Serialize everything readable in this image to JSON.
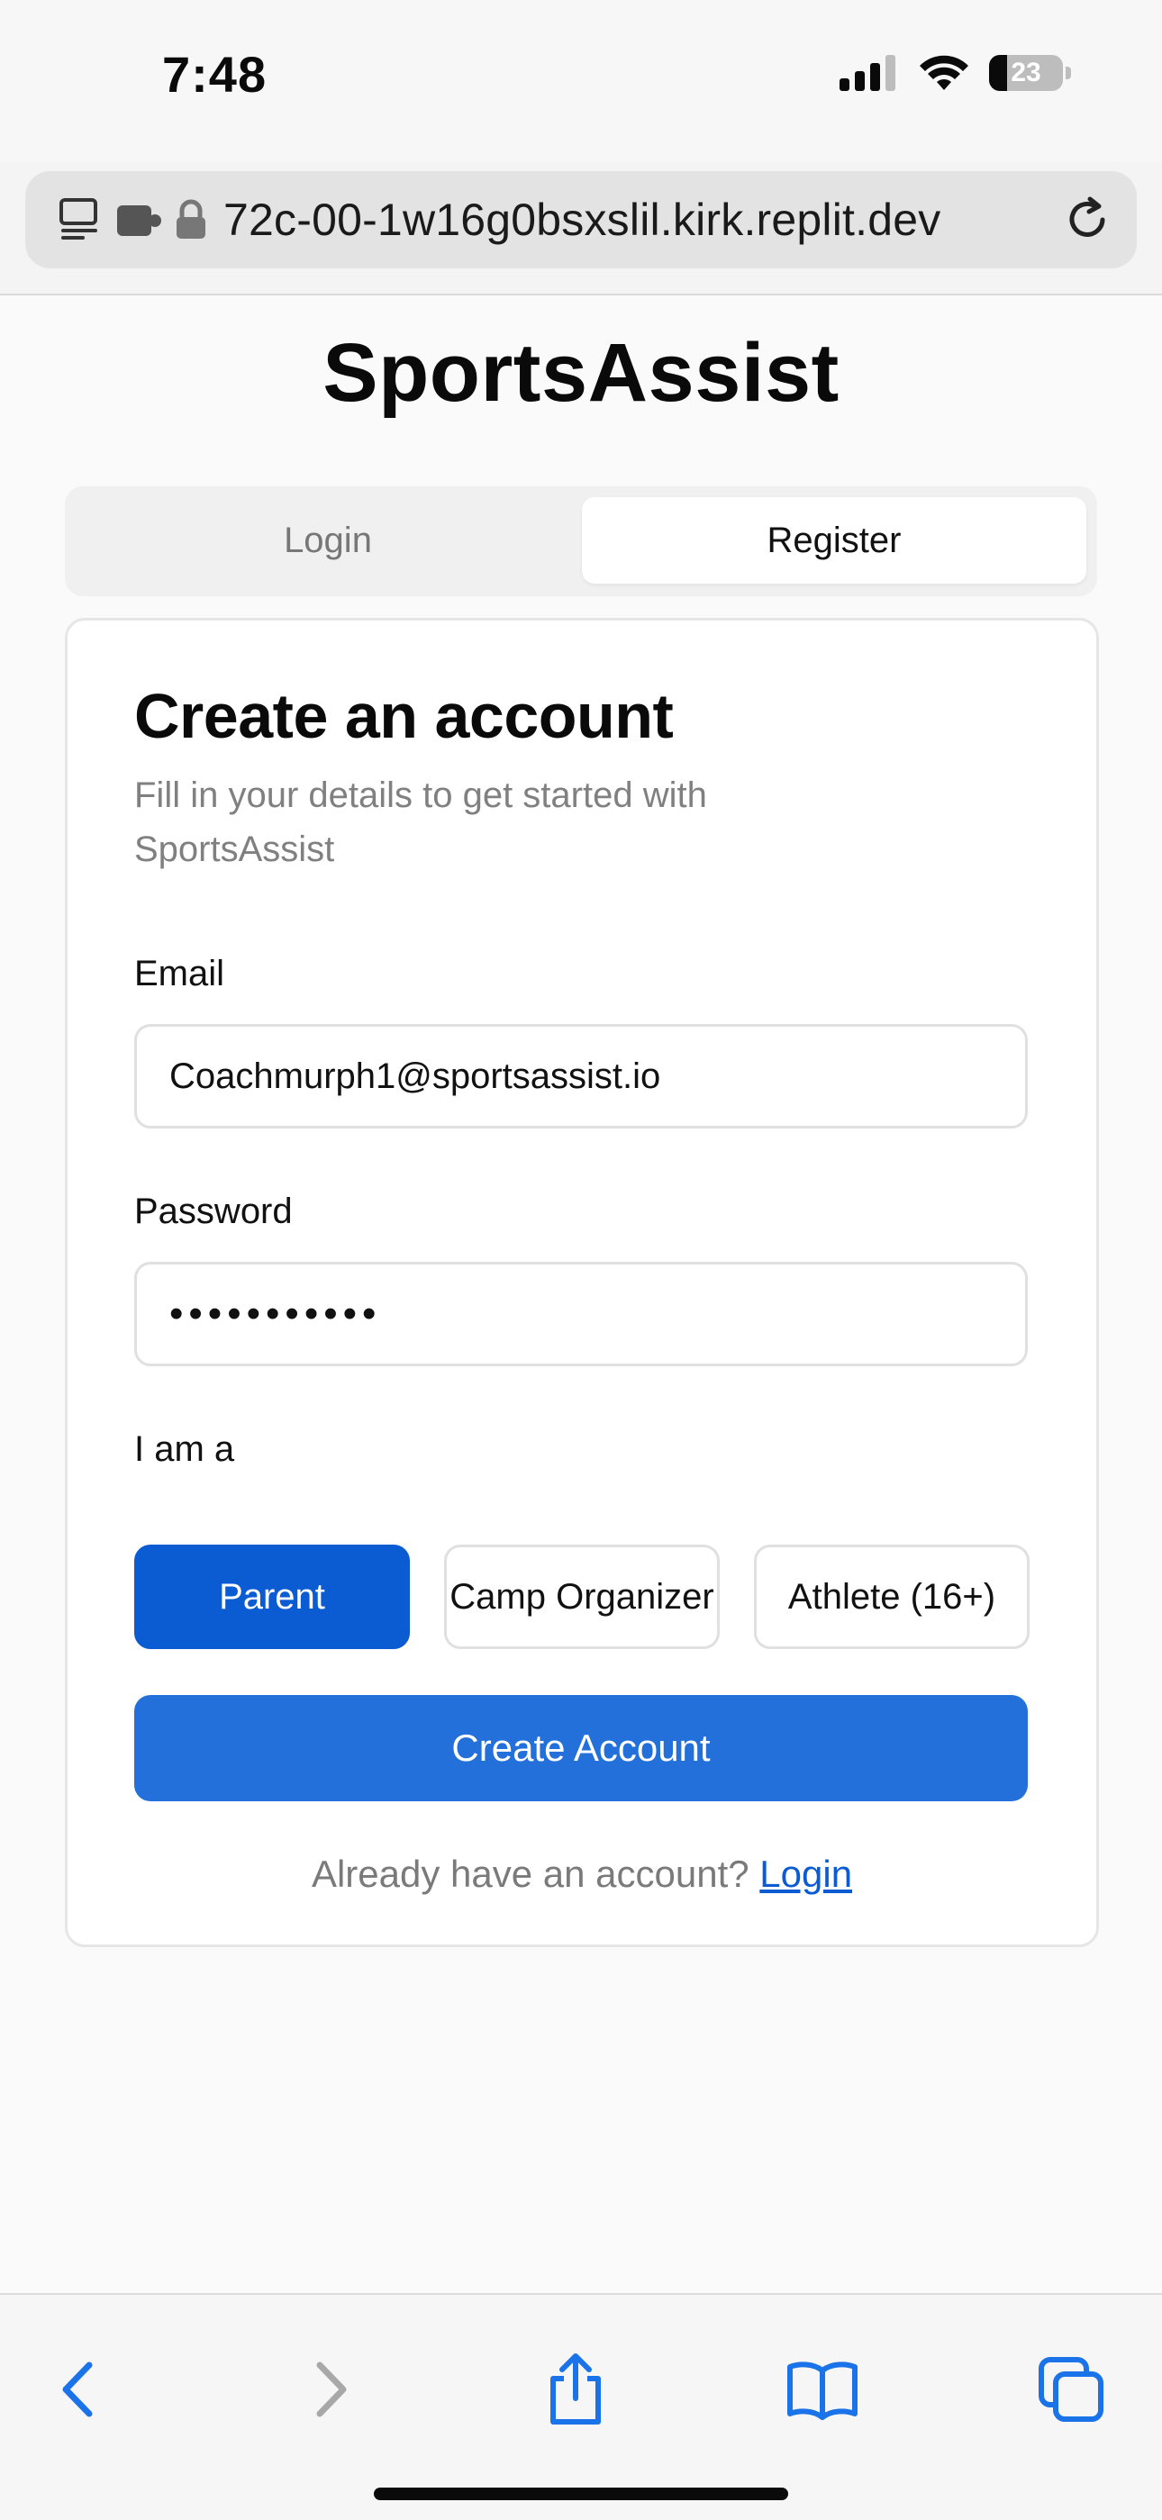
{
  "status_bar": {
    "time": "7:48",
    "battery": "23"
  },
  "browser": {
    "url": "72c-00-1w16g0bsxslil.kirk.replit.dev"
  },
  "app": {
    "brand": "SportsAssist"
  },
  "tabs": {
    "login": "Login",
    "register": "Register",
    "active": "register"
  },
  "form": {
    "title": "Create an account",
    "subtitle": "Fill in your details to get started with SportsAssist",
    "email_label": "Email",
    "email_value": "Coachmurph1@sportsassist.io",
    "password_label": "Password",
    "password_value": "•••••••••••",
    "role_label": "I am a",
    "roles": [
      "Parent",
      "Camp Organizer",
      "Athlete (16+)"
    ],
    "selected_role": "Parent",
    "submit_label": "Create Account",
    "already_text": "Already have an account?",
    "login_link": "Login"
  },
  "colors": {
    "primary": "#2370db",
    "selected": "#0b5bd3",
    "link": "#0b5bd3"
  },
  "toolbar_icons": [
    "back-icon",
    "forward-icon",
    "share-icon",
    "bookmarks-icon",
    "tabs-icon"
  ]
}
